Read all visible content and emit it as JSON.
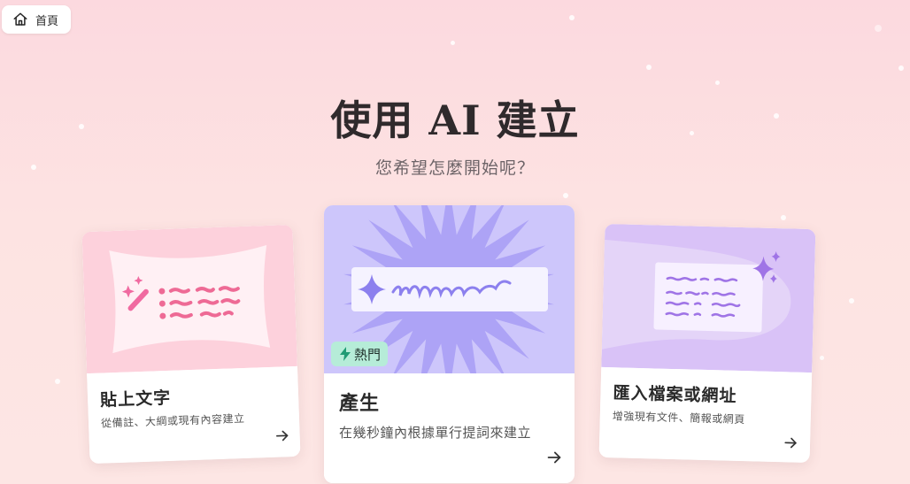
{
  "home": {
    "label": "首頁"
  },
  "header": {
    "title": "使用 AI 建立",
    "subtitle": "您希望怎麼開始呢？"
  },
  "cards": [
    {
      "title": "貼上文字",
      "description": "從備註、大綱或現有內容建立"
    },
    {
      "title": "產生",
      "description": "在幾秒鐘內根據單行提詞來建立",
      "badge": "熱門"
    },
    {
      "title": "匯入檔案或網址",
      "description": "增強現有文件、簡報或網頁"
    }
  ],
  "colors": {
    "background": "#fcd9df",
    "card1_art": "#fdd1dc",
    "card2_art": "#cdc6fb",
    "card3_art": "#d9c2f7",
    "badge": "#b6ecd8"
  },
  "icons": [
    "home-icon",
    "magic-wand-icon",
    "sparkle-icon",
    "lightning-icon",
    "arrow-right-icon"
  ]
}
